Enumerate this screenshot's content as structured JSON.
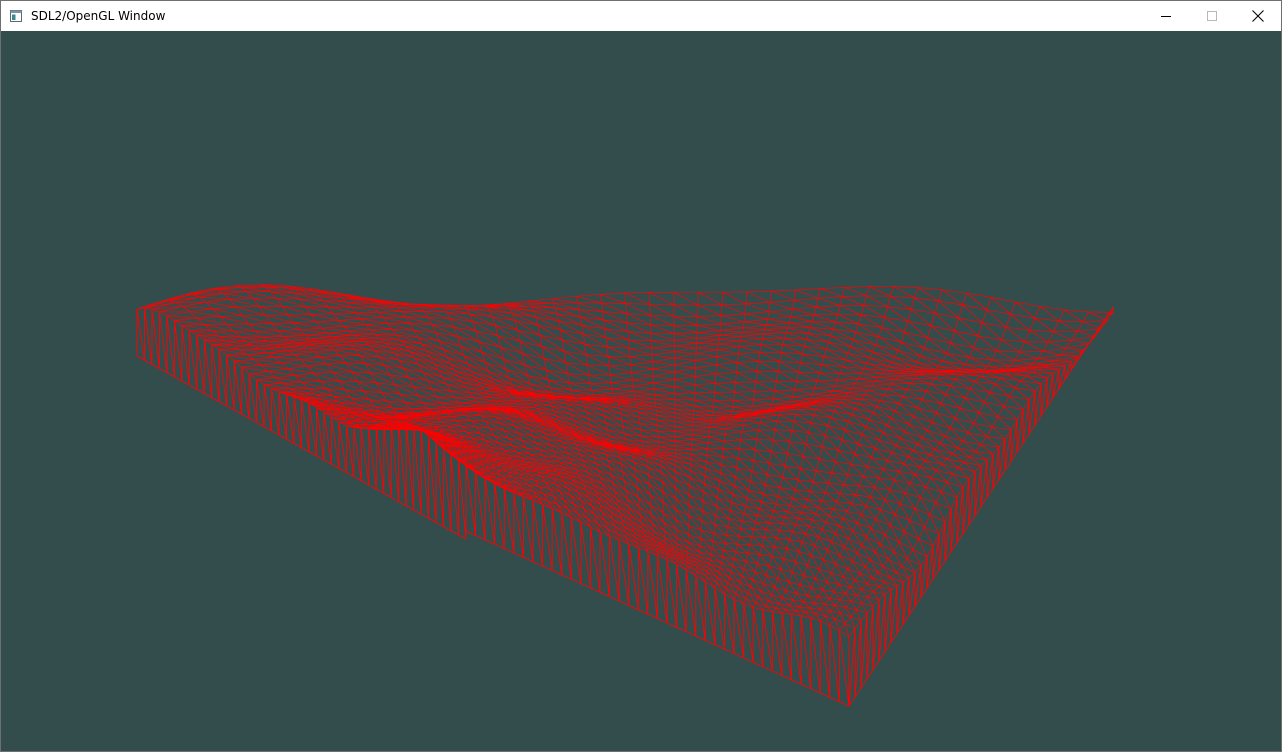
{
  "window": {
    "title": "SDL2/OpenGL Window",
    "icons": {
      "app": "application-window-icon",
      "minimize": "minimize-icon",
      "maximize": "maximize-icon",
      "close": "close-icon"
    }
  },
  "scene": {
    "description_icon": "terrain-wireframe",
    "clear_color": "#334d4d",
    "wire_color": "#ff0000"
  }
}
